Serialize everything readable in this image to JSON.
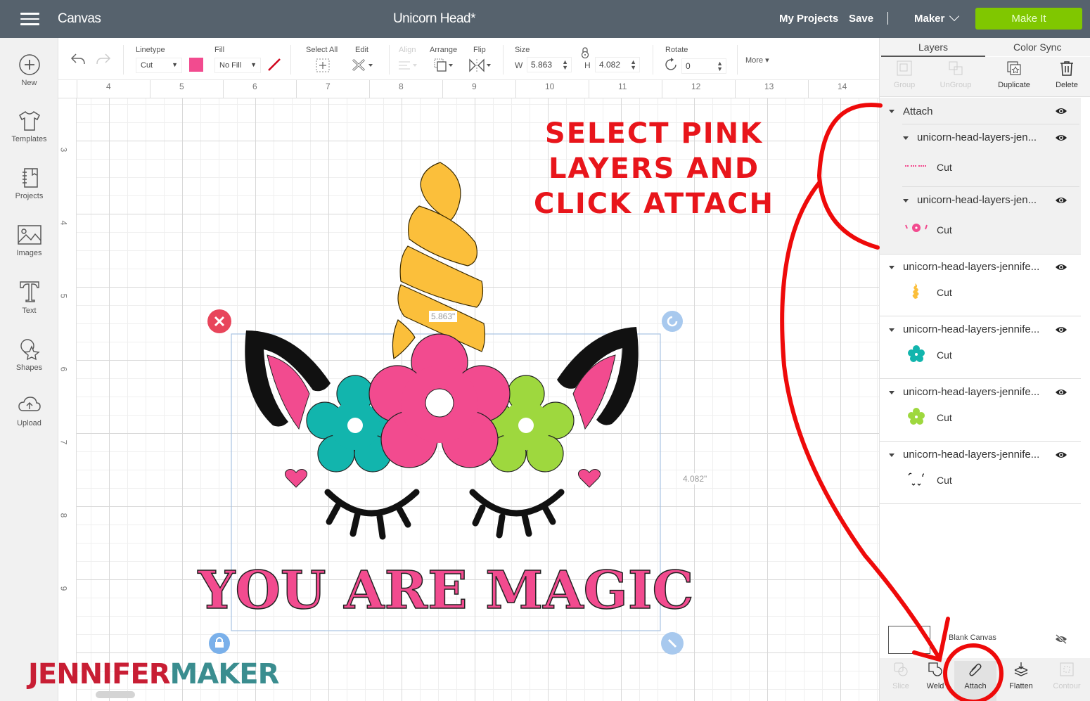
{
  "header": {
    "app_title": "Canvas",
    "doc_title": "Unicorn Head*",
    "my_projects": "My Projects",
    "save": "Save",
    "machine": "Maker",
    "make_it": "Make It",
    "make_it_color": "#80c700"
  },
  "sidebar": {
    "items": [
      {
        "label": "New",
        "icon": "plus-circle-icon"
      },
      {
        "label": "Templates",
        "icon": "tshirt-icon"
      },
      {
        "label": "Projects",
        "icon": "notebook-icon"
      },
      {
        "label": "Images",
        "icon": "image-icon"
      },
      {
        "label": "Text",
        "icon": "text-t-icon"
      },
      {
        "label": "Shapes",
        "icon": "shapes-icon"
      },
      {
        "label": "Upload",
        "icon": "cloud-upload-icon"
      }
    ]
  },
  "toolbar": {
    "linetype_label": "Linetype",
    "linetype_value": "Cut",
    "linetype_color": "#f24b8f",
    "fill_label": "Fill",
    "fill_value": "No Fill",
    "select_all_label": "Select All",
    "edit_label": "Edit",
    "align_label": "Align",
    "arrange_label": "Arrange",
    "flip_label": "Flip",
    "size_label": "Size",
    "w_label": "W",
    "w_value": "5.863",
    "h_label": "H",
    "h_value": "4.082",
    "rotate_label": "Rotate",
    "rotate_value": "0",
    "more_label": "More ▾"
  },
  "rulers": {
    "horizontal": [
      "4",
      "5",
      "6",
      "7",
      "8",
      "9",
      "10",
      "11",
      "12",
      "13",
      "14"
    ],
    "vertical": [
      "3",
      "4",
      "5",
      "6",
      "7",
      "8",
      "9"
    ]
  },
  "canvas": {
    "width_label": "5.863\"",
    "height_label": "4.082\"",
    "design_text": "YOU ARE MAGIC",
    "annotation": [
      "SELECT PINK",
      "LAYERS AND",
      "CLICK ATTACH"
    ],
    "colors": {
      "pink": "#f24b8f",
      "teal": "#12b5ad",
      "green": "#9ed83e",
      "yellow": "#fbbf3b",
      "black": "#111111",
      "annotation_red": "#e8151b"
    }
  },
  "panel": {
    "tabs": [
      "Layers",
      "Color Sync"
    ],
    "actions": [
      {
        "label": "Group",
        "enabled": false
      },
      {
        "label": "UnGroup",
        "enabled": false
      },
      {
        "label": "Duplicate",
        "enabled": true
      },
      {
        "label": "Delete",
        "enabled": true
      }
    ],
    "group": {
      "name": "Attach",
      "children": [
        {
          "name": "unicorn-head-layers-jen...",
          "type": "Cut",
          "thumb": "pink-text"
        },
        {
          "name": "unicorn-head-layers-jen...",
          "type": "Cut",
          "thumb": "pink-flower"
        }
      ]
    },
    "layers": [
      {
        "name": "unicorn-head-layers-jennife...",
        "type": "Cut",
        "thumb": "yellow-horn"
      },
      {
        "name": "unicorn-head-layers-jennife...",
        "type": "Cut",
        "thumb": "teal-flower"
      },
      {
        "name": "unicorn-head-layers-jennife...",
        "type": "Cut",
        "thumb": "green-flower"
      },
      {
        "name": "unicorn-head-layers-jennife...",
        "type": "Cut",
        "thumb": "black-ears"
      }
    ],
    "blank_canvas": "Blank Canvas",
    "bottom_tools": [
      {
        "label": "Slice",
        "enabled": false
      },
      {
        "label": "Weld",
        "enabled": true
      },
      {
        "label": "Attach",
        "enabled": true
      },
      {
        "label": "Flatten",
        "enabled": true
      },
      {
        "label": "Contour",
        "enabled": false
      }
    ]
  },
  "watermark": {
    "part1": "JENNIFER",
    "part2": "MAKER"
  }
}
